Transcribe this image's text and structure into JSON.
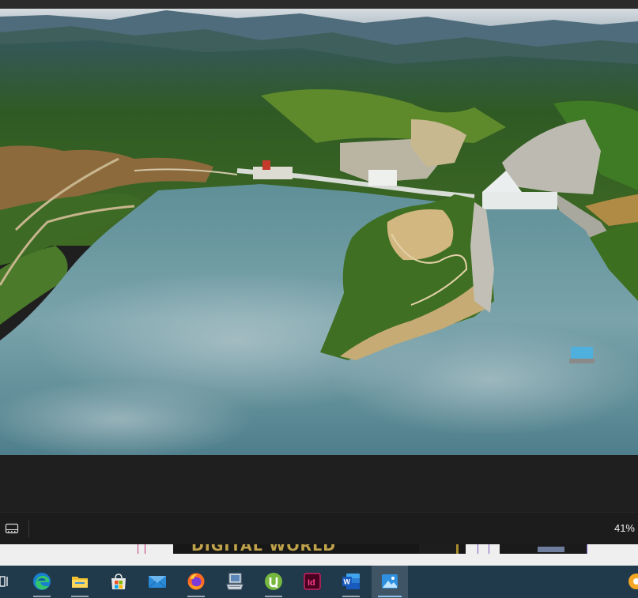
{
  "viewer": {
    "zoom_level": "41%",
    "status_bar": {
      "filmstrip_icon": "filmstrip-icon"
    }
  },
  "photo": {
    "subject": "aerial-photo",
    "colors": {
      "water": "#6e9ca6",
      "forest": "#2f5a22",
      "sky": "#c9d2d8"
    }
  },
  "background_window": {
    "banner_text": "DIGITAL WORLD"
  },
  "taskbar": {
    "items": [
      {
        "name": "task-view",
        "icon": "task-view-icon"
      },
      {
        "name": "edge",
        "icon": "edge-icon"
      },
      {
        "name": "file-explorer",
        "icon": "folder-icon"
      },
      {
        "name": "microsoft-store",
        "icon": "store-icon"
      },
      {
        "name": "mail",
        "icon": "mail-icon"
      },
      {
        "name": "firefox",
        "icon": "firefox-icon"
      },
      {
        "name": "network-app",
        "icon": "computer-icon"
      },
      {
        "name": "utorrent",
        "icon": "utorrent-icon"
      },
      {
        "name": "indesign",
        "icon": "indesign-icon",
        "label": "Id"
      },
      {
        "name": "word",
        "icon": "word-icon",
        "label": "W"
      },
      {
        "name": "photos",
        "icon": "photos-icon",
        "active": true
      },
      {
        "name": "tray-app",
        "icon": "tray-app-icon"
      }
    ]
  }
}
